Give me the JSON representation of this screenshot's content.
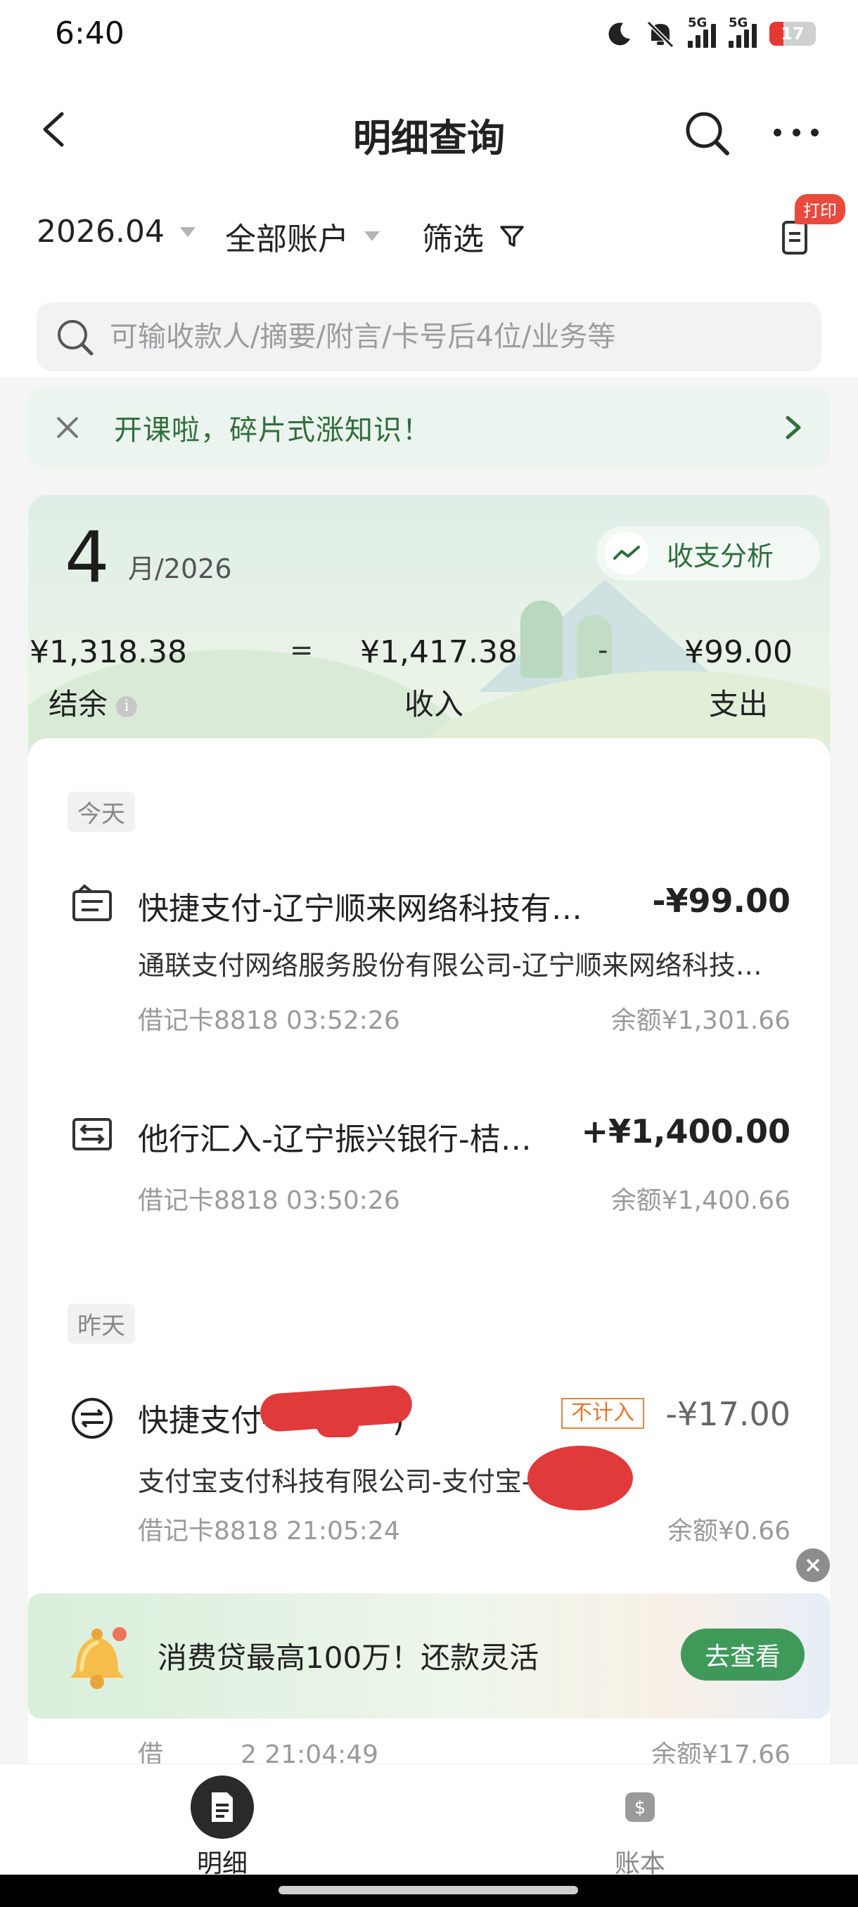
{
  "status": {
    "time": "6:40",
    "battery": "17",
    "net1": "5G",
    "net2": "5G"
  },
  "header": {
    "title": "明细查询"
  },
  "filters": {
    "period": "2026.04",
    "account": "全部账户",
    "filter": "筛选",
    "print_badge": "打印"
  },
  "search": {
    "placeholder": "可输收款人/摘要/附言/卡号后4位/业务等"
  },
  "notice": {
    "text": "开课啦，碎片式涨知识！"
  },
  "summary": {
    "month": "4",
    "month_suffix": "月/2026",
    "analysis_label": "收支分析",
    "balance": "¥1,318.38",
    "balance_label": "结余",
    "income": "¥1,417.38",
    "income_label": "收入",
    "expense": "¥99.00",
    "expense_label": "支出",
    "op_equals": "=",
    "op_minus": "-"
  },
  "days": [
    {
      "label": "今天",
      "transactions": [
        {
          "title": "快捷支付-辽宁顺来网络科技有…",
          "amount": "-¥99.00",
          "subtitle": "通联支付网络服务股份有限公司-辽宁顺来网络科技…",
          "meta": "借记卡8818 03:52:26",
          "balance": "余额¥1,301.66"
        },
        {
          "title": "他行汇入-辽宁振兴银行-桔…",
          "amount": "+¥1,400.00",
          "meta": "借记卡8818 03:50:26",
          "balance": "余额¥1,400.66"
        }
      ]
    },
    {
      "label": "昨天",
      "transactions": [
        {
          "title": "快捷支付-",
          "title_tail": ")",
          "badge": "不计入",
          "amount": "-¥17.00",
          "subtitle": "支付宝支付科技有限公司-支付宝-",
          "meta": "借记卡8818 21:05:24",
          "balance": "余额¥0.66"
        },
        {
          "meta": "借",
          "meta_tail": "2 21:04:49",
          "balance": "余额¥17.66"
        }
      ]
    }
  ],
  "promo": {
    "text": "消费贷最高100万！还款灵活",
    "button": "去查看"
  },
  "nav": {
    "items": [
      {
        "label": "明细",
        "active": true
      },
      {
        "label": "账本",
        "active": false
      }
    ]
  },
  "colors": {
    "brand_green": "#2f6e3b",
    "promo_button": "#3f9a5a",
    "badge_red": "#e84a3d",
    "excluded_orange": "#e07a2e"
  }
}
